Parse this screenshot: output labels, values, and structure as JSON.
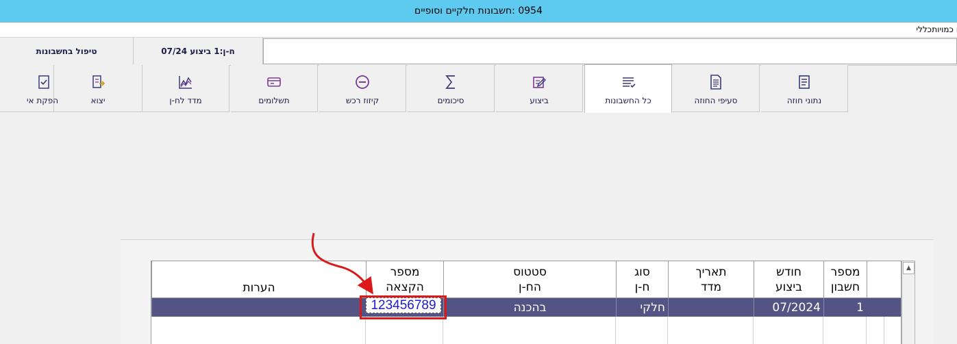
{
  "window": {
    "title": "0954 :חשבונות חלקיים וסופיים"
  },
  "menu": {
    "general": "כללי",
    "quantities": "ו כמויות"
  },
  "info": {
    "handling": "טיפול בחשבונות",
    "account": "ח-ן:1 ביצוע 07/24"
  },
  "toolbar": {
    "items": [
      {
        "label": "נתוני חוזה",
        "icon": "contract-data-icon"
      },
      {
        "label": "סעיפי החוזה",
        "icon": "contract-items-icon"
      },
      {
        "label": "כל החשבונות",
        "icon": "all-accounts-icon"
      },
      {
        "label": "ביצוע",
        "icon": "execution-icon"
      },
      {
        "label": "סיכומים",
        "icon": "sum-icon"
      },
      {
        "label": "קיזוז רכש",
        "icon": "purchase-offset-icon"
      },
      {
        "label": "תשלומים",
        "icon": "payments-icon"
      },
      {
        "label": "מדד לח-ן",
        "icon": "index-chart-icon"
      },
      {
        "label": "יצוא",
        "icon": "export-icon"
      },
      {
        "label": "הפקת אי",
        "icon": "produce-icon"
      }
    ]
  },
  "grid": {
    "headers": {
      "account_no": "מספר\nחשבון",
      "exec_month": "חודש\nביצוע",
      "index_date": "תאריך\nמדד",
      "type": "סוג\nח-ן",
      "status": "סטטוס\nהח-ן",
      "alloc_no": "מספר\nהקצאה",
      "notes": "הערות"
    },
    "row": {
      "account_no": "1",
      "exec_month": "07/2024",
      "index_date": "",
      "type": "חלקי",
      "status": "בהכנה",
      "alloc_no": "123456789",
      "notes": ""
    }
  },
  "colors": {
    "titlebar": "#5ecaf0",
    "selected_row": "#545484",
    "highlight": "#dd1818",
    "alloc_text": "#1a1ad2"
  }
}
